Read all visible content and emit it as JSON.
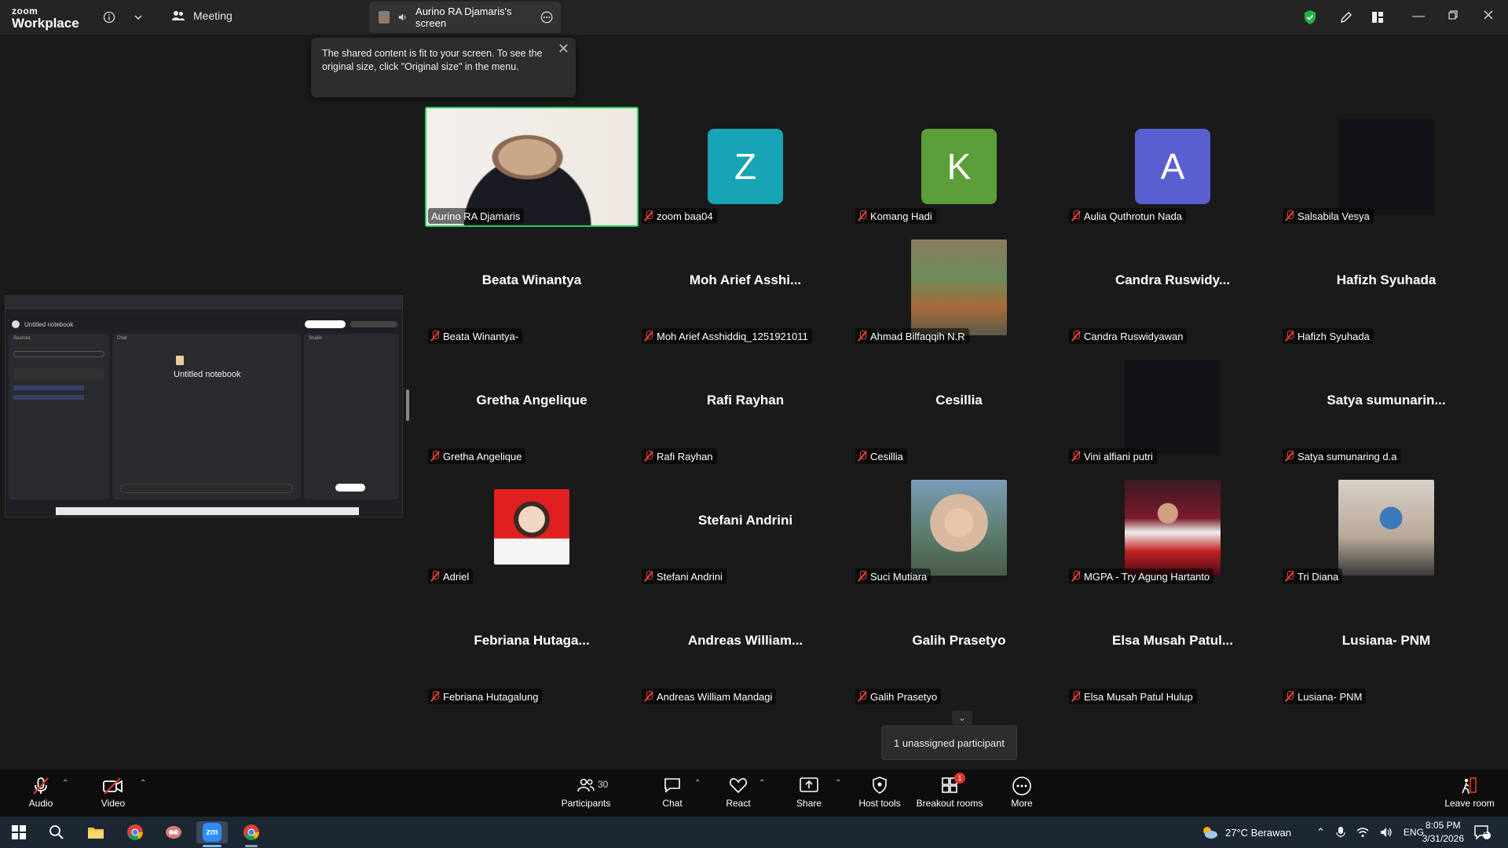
{
  "titlebar": {
    "brand_top": "zoom",
    "brand_bottom": "Workplace",
    "meeting_label": "Meeting",
    "share_tab_label": "Aurino RA Djamaris's screen"
  },
  "tooltip": {
    "text": "The shared content is fit to your screen. To see the original size, click \"Original size\" in the menu."
  },
  "shared_screen": {
    "notebook_title": "Untitled notebook",
    "header_title": "Untitled notebook",
    "col_sources": "Sources",
    "col_chat": "Chat",
    "col_studio": "Studio"
  },
  "participants": [
    {
      "label": "Aurino RA Djamaris",
      "type": "video",
      "muted": false
    },
    {
      "label": "zoom baa04",
      "type": "letter",
      "letter": "Z",
      "color": "#17a5b5",
      "muted": true
    },
    {
      "label": "Komang Hadi",
      "type": "letter",
      "letter": "K",
      "color": "#5c9e3a",
      "muted": true
    },
    {
      "label": "Aulia Quthrotun Nada",
      "type": "letter",
      "letter": "A",
      "color": "#5a5fcf",
      "muted": true
    },
    {
      "label": "Salsabila Vesya",
      "type": "dark",
      "muted": true
    },
    {
      "label": "Beata Winantya-",
      "big": "Beata Winantya",
      "muted": true
    },
    {
      "label": "Moh Arief Asshiddiq_1251921011",
      "big": "Moh Arief Asshi...",
      "muted": true
    },
    {
      "label": "Ahmad Bilfaqqih N.R",
      "type": "photo",
      "muted": true
    },
    {
      "label": "Candra Ruswidyawan",
      "big": "Candra Ruswidy...",
      "muted": true
    },
    {
      "label": "Hafizh Syuhada",
      "big": "Hafizh Syuhada",
      "muted": true
    },
    {
      "label": "Gretha Angelique",
      "big": "Gretha Angelique",
      "muted": true
    },
    {
      "label": "Rafi Rayhan",
      "big": "Rafi Rayhan",
      "muted": true
    },
    {
      "label": "Cesillia",
      "big": "Cesillia",
      "muted": true
    },
    {
      "label": "Vini alfiani putri",
      "type": "dark",
      "muted": true
    },
    {
      "label": "Satya sumunaring d.a",
      "big": "Satya sumunarin...",
      "muted": true
    },
    {
      "label": "Adriel",
      "type": "photo",
      "muted": true
    },
    {
      "label": "Stefani Andrini",
      "big": "Stefani Andrini",
      "muted": true
    },
    {
      "label": "Suci Mutiara",
      "type": "photo",
      "muted": true
    },
    {
      "label": "MGPA - Try Agung Hartanto",
      "type": "photo",
      "muted": true
    },
    {
      "label": "Tri Diana",
      "type": "photo",
      "muted": true
    },
    {
      "label": "Febriana Hutagalung",
      "big": "Febriana Hutaga...",
      "muted": true
    },
    {
      "label": "Andreas William Mandagi",
      "big": "Andreas William...",
      "muted": true
    },
    {
      "label": "Galih Prasetyo",
      "big": "Galih Prasetyo",
      "muted": true
    },
    {
      "label": "Elsa Musah Patul Hulup",
      "big": "Elsa Musah Patul...",
      "muted": true
    },
    {
      "label": "Lusiana- PNM",
      "big": "Lusiana- PNM",
      "muted": true
    }
  ],
  "unassigned": "1 unassigned participant",
  "toolbar": {
    "audio": "Audio",
    "video": "Video",
    "participants": "Participants",
    "participants_count": "30",
    "chat": "Chat",
    "react": "React",
    "share": "Share",
    "host_tools": "Host tools",
    "breakout_rooms": "Breakout rooms",
    "breakout_badge": "1",
    "more": "More",
    "leave_room": "Leave room"
  },
  "taskbar": {
    "weather": "27°C  Berawan",
    "language": "ENG",
    "time": "8:05 PM",
    "date": "3/31/2026",
    "notif_count": "1"
  }
}
